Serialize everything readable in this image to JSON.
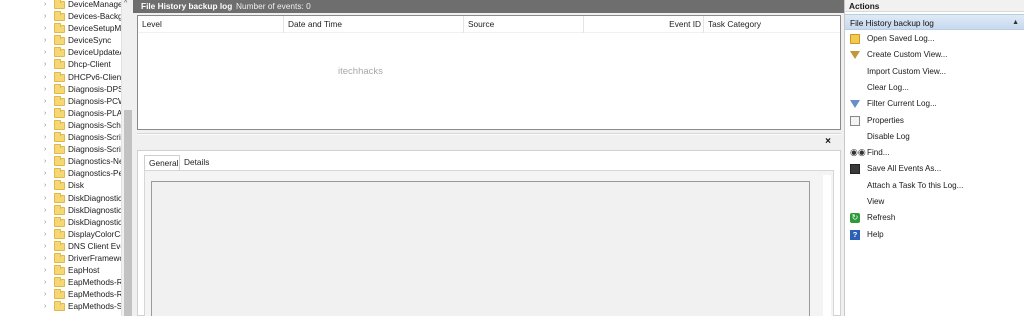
{
  "tree": {
    "items": [
      "DeviceManage",
      "Devices-Backg",
      "DeviceSetupM",
      "DeviceSync",
      "DeviceUpdateA",
      "Dhcp-Client",
      "DHCPv6-Client",
      "Diagnosis-DPS",
      "Diagnosis-PCW",
      "Diagnosis-PLA",
      "Diagnosis-Sche",
      "Diagnosis-Scrip",
      "Diagnosis-Scrip",
      "Diagnostics-Ne",
      "Diagnostics-Pe",
      "Disk",
      "DiskDiagnostic",
      "DiskDiagnostic",
      "DiskDiagnostic",
      "DisplayColorCa",
      "DNS Client Eve",
      "DriverFramewc",
      "EapHost",
      "EapMethods-R",
      "EapMethods-R",
      "EapMethods-S"
    ]
  },
  "log_header": {
    "title": "File History backup log",
    "event_count": "Number of events: 0"
  },
  "grid": {
    "columns": [
      "Level",
      "Date and Time",
      "Source",
      "Event ID",
      "Task Category"
    ],
    "watermark": "itechhacks"
  },
  "details": {
    "close_label": "×",
    "tabs": [
      "General",
      "Details"
    ]
  },
  "actions": {
    "title": "Actions",
    "section": "File History backup log",
    "items": [
      {
        "label": "Open Saved Log...",
        "icon": "open-folder-icon"
      },
      {
        "label": "Create Custom View...",
        "icon": "filter-icon"
      },
      {
        "label": "Import Custom View...",
        "icon": ""
      },
      {
        "label": "Clear Log...",
        "icon": ""
      },
      {
        "label": "Filter Current Log...",
        "icon": "filter-icon"
      },
      {
        "label": "Properties",
        "icon": "properties-icon"
      },
      {
        "label": "Disable Log",
        "icon": ""
      },
      {
        "label": "Find...",
        "icon": "binoculars-icon"
      },
      {
        "label": "Save All Events As...",
        "icon": "save-icon"
      },
      {
        "label": "Attach a Task To this Log...",
        "icon": ""
      },
      {
        "label": "View",
        "icon": ""
      },
      {
        "label": "Refresh",
        "icon": "refresh-icon"
      },
      {
        "label": "Help",
        "icon": "help-icon"
      }
    ]
  }
}
